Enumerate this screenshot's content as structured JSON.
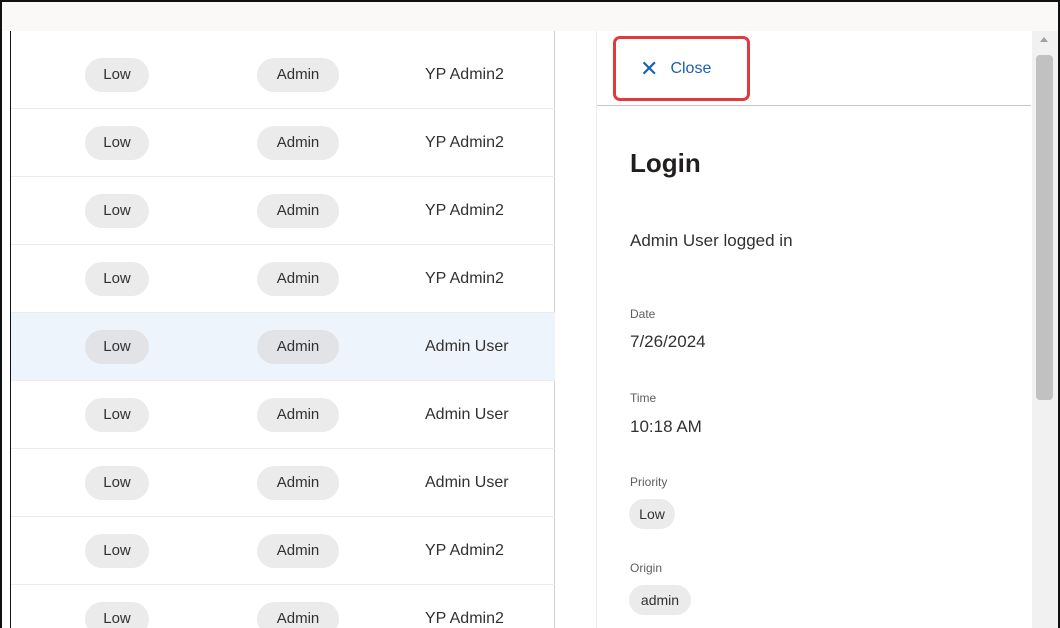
{
  "rows": [
    {
      "priority": "Low",
      "origin": "Admin",
      "user": "YP Admin2"
    },
    {
      "priority": "Low",
      "origin": "Admin",
      "user": "YP Admin2"
    },
    {
      "priority": "Low",
      "origin": "Admin",
      "user": "YP Admin2"
    },
    {
      "priority": "Low",
      "origin": "Admin",
      "user": "YP Admin2"
    },
    {
      "priority": "Low",
      "origin": "Admin",
      "user": "Admin User",
      "selected": true
    },
    {
      "priority": "Low",
      "origin": "Admin",
      "user": "Admin User"
    },
    {
      "priority": "Low",
      "origin": "Admin",
      "user": "Admin User"
    },
    {
      "priority": "Low",
      "origin": "Admin",
      "user": "YP Admin2"
    },
    {
      "priority": "Low",
      "origin": "Admin",
      "user": "YP Admin2"
    }
  ],
  "panel": {
    "close_label": "Close",
    "close_icon": "close-icon",
    "title": "Login",
    "description": "Admin User logged in",
    "date_label": "Date",
    "date_value": "7/26/2024",
    "time_label": "Time",
    "time_value": "10:18 AM",
    "priority_label": "Priority",
    "priority_value": "Low",
    "origin_label": "Origin",
    "origin_value": "admin"
  },
  "colors": {
    "accent": "#1a5fb4",
    "highlight_border": "#e03a3e",
    "selected_row": "#eef4fb",
    "pill_bg": "#ebebeb"
  }
}
